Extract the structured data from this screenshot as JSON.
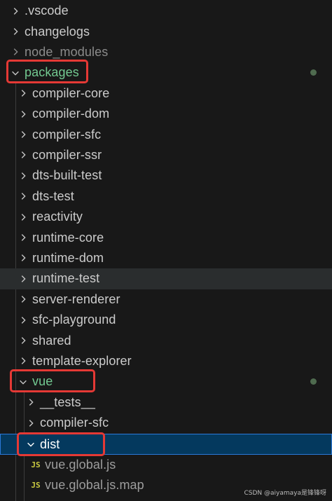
{
  "explorer": {
    "root_items": [
      {
        "label": ".vscode",
        "state": "collapsed"
      },
      {
        "label": "changelogs",
        "state": "collapsed"
      },
      {
        "label": "node_modules",
        "state": "collapsed"
      },
      {
        "label": "packages",
        "state": "expanded"
      }
    ],
    "packages_children": [
      "compiler-core",
      "compiler-dom",
      "compiler-sfc",
      "compiler-ssr",
      "dts-built-test",
      "dts-test",
      "reactivity",
      "runtime-core",
      "runtime-dom",
      "runtime-test",
      "server-renderer",
      "sfc-playground",
      "shared",
      "template-explorer",
      "vue"
    ],
    "vue_children": [
      "__tests__",
      "compiler-sfc",
      "dist"
    ],
    "dist_children": [
      {
        "label": "vue.global.js",
        "icon_text": "JS"
      },
      {
        "label": "vue.global.js.map",
        "icon_text": "JS"
      }
    ],
    "hovered_item": "runtime-test",
    "selected_item": "dist",
    "git_modified_color": "#73c991",
    "selection_color": "#04395e",
    "annotation_color": "#e53935"
  },
  "watermark": "CSDN @aiyamaya是锋锋呀"
}
